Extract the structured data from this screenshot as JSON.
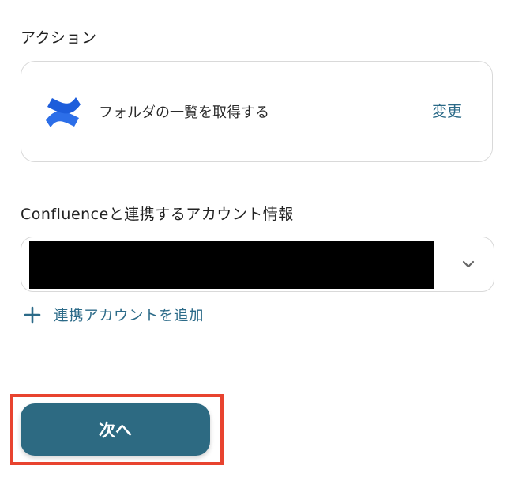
{
  "action": {
    "section_label": "アクション",
    "logo_icon": "confluence-logo-icon",
    "description": "フォルダの一覧を取得する",
    "change_label": "変更"
  },
  "account": {
    "section_label": "Confluenceと連携するアカウント情報",
    "selected_value_redacted": true,
    "chevron_icon": "chevron-down-icon",
    "add_account_label": "連携アカウントを追加",
    "add_icon": "plus-icon"
  },
  "footer": {
    "next_label": "次へ"
  },
  "colors": {
    "accent_text": "#2b6a88",
    "primary_button": "#2d6a82",
    "highlight_frame": "#e8432f",
    "logo_blue_dark": "#1d5ddb",
    "logo_blue_light": "#3a8cf5"
  }
}
